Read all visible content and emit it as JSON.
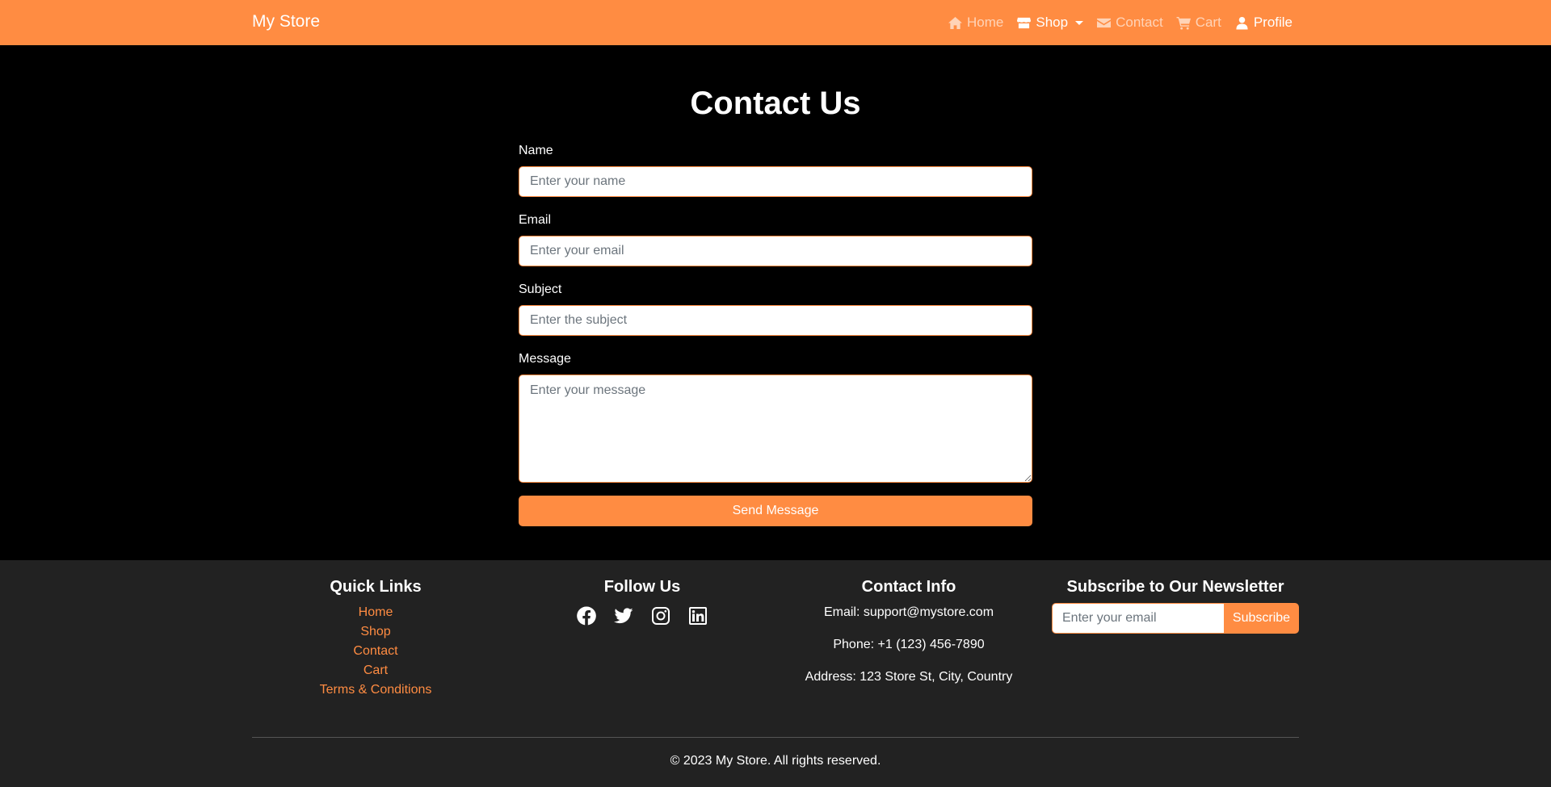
{
  "navbar": {
    "brand": "My Store",
    "items": [
      {
        "label": "Home",
        "icon": "home-icon"
      },
      {
        "label": "Shop",
        "icon": "store-icon"
      },
      {
        "label": "Contact",
        "icon": "envelope-icon"
      },
      {
        "label": "Cart",
        "icon": "cart-icon"
      },
      {
        "label": "Profile",
        "icon": "user-icon"
      }
    ],
    "color": "#ff8c42"
  },
  "contact": {
    "title": "Contact Us",
    "fields": {
      "name": {
        "label": "Name",
        "placeholder": "Enter your name"
      },
      "email": {
        "label": "Email",
        "placeholder": "Enter your email"
      },
      "subject": {
        "label": "Subject",
        "placeholder": "Enter the subject"
      },
      "message": {
        "label": "Message",
        "placeholder": "Enter your message"
      }
    },
    "submit_label": "Send Message"
  },
  "footer": {
    "quick_links": {
      "title": "Quick Links",
      "items": [
        "Home",
        "Shop",
        "Contact",
        "Cart",
        "Terms & Conditions"
      ]
    },
    "follow": {
      "title": "Follow Us",
      "icons": [
        "facebook-icon",
        "twitter-icon",
        "instagram-icon",
        "linkedin-icon"
      ]
    },
    "contact_info": {
      "title": "Contact Info",
      "email": "Email: support@mystore.com",
      "phone": "Phone: +1 (123) 456-7890",
      "address": "Address: 123 Store St, City, Country"
    },
    "newsletter": {
      "title": "Subscribe to Our Newsletter",
      "placeholder": "Enter your email",
      "button": "Subscribe"
    },
    "copyright": "© 2023 My Store. All rights reserved."
  },
  "colors": {
    "accent": "#ff8c42",
    "footer_bg": "#222222",
    "main_bg": "#000000"
  }
}
